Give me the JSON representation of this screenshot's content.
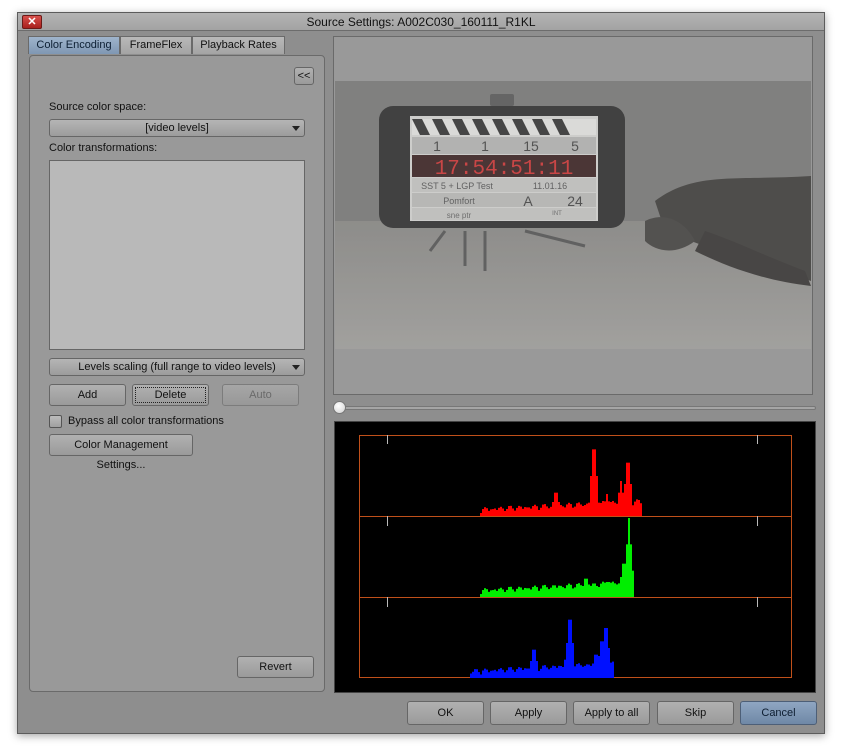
{
  "window": {
    "title": "Source Settings: A002C030_160111_R1KL",
    "close_glyph": "✕"
  },
  "tabs": [
    {
      "label": "Color Encoding",
      "active": true
    },
    {
      "label": "FrameFlex",
      "active": false
    },
    {
      "label": "Playback Rates",
      "active": false
    }
  ],
  "left_panel": {
    "collapse_label": "<<",
    "source_color_space_label": "Source color space:",
    "source_color_space_value": "[video levels]",
    "color_transformations_label": "Color transformations:",
    "color_transformations_items": [],
    "levels_scaling_value": "Levels scaling (full range to video levels)",
    "add_label": "Add",
    "delete_label": "Delete",
    "auto_label": "Auto",
    "bypass_label": "Bypass all color transformations",
    "bypass_checked": false,
    "color_management_label": "Color Management Settings...",
    "revert_label": "Revert"
  },
  "preview": {
    "slate": {
      "row1": [
        "1",
        "1",
        "15",
        "5"
      ],
      "timecode": "17:54:51:11",
      "prod": "SST 5 + LGP Test",
      "date": "11.01.16",
      "dop": "Pomfort",
      "cam": "A",
      "fps": "24",
      "notes": "sne ptr",
      "int_label": "INT"
    },
    "playhead_position": 0
  },
  "histogram": {
    "channels": [
      "red",
      "green",
      "blue"
    ],
    "colors": {
      "red": "#ff0000",
      "green": "#00ee00",
      "blue": "#0010ff",
      "frame": "#c0501a"
    }
  },
  "footer": {
    "ok_label": "OK",
    "apply_label": "Apply",
    "apply_all_label": "Apply to all",
    "skip_label": "Skip",
    "cancel_label": "Cancel"
  },
  "colors": {
    "window_bg": "#8e8e8e",
    "tab_active": "#7f97b3",
    "cancel_accent": "#6f88a6"
  }
}
